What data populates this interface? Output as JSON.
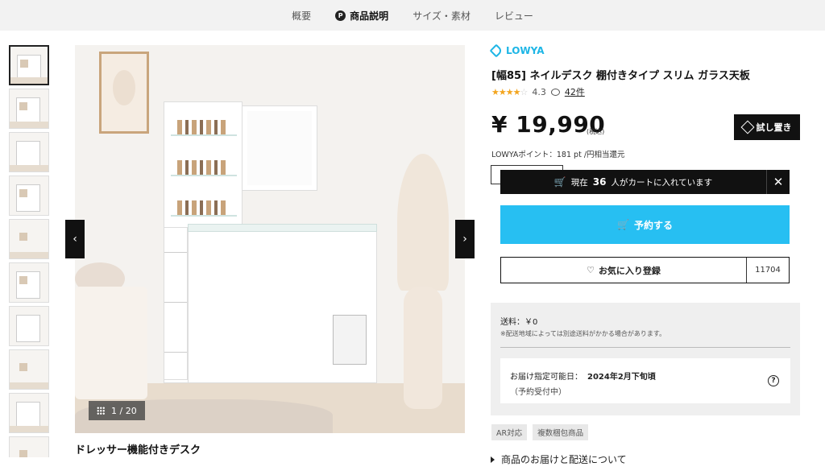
{
  "topnav": {
    "tabs": [
      {
        "label": "概要"
      },
      {
        "label": "商品説明"
      },
      {
        "label": "サイズ・素材"
      },
      {
        "label": "レビュー"
      }
    ],
    "active_tab": "商品説明"
  },
  "gallery": {
    "counter": "1 / 20",
    "caption": "ドレッサー機能付きデスク",
    "thumbnail_count": 10
  },
  "product": {
    "brand": "LOWYA",
    "title": "[幅85] ネイルデスク 棚付きタイプ スリム ガラス天板",
    "rating_value": "4.3",
    "stars_filled": 4,
    "reviews": "42件",
    "price": "¥ 19,990",
    "tax": "(税込)",
    "try_button": "試し置き",
    "points": "LOWYAポイント：181 pt /円相当還元"
  },
  "cart_banner": {
    "prefix": "現在",
    "count": "36",
    "suffix": "人がカートに入れています"
  },
  "actions": {
    "reserve": "予約する",
    "favorite": "お気に入り登録",
    "favorite_count": "11704"
  },
  "shipping": {
    "fee": "送料：￥0",
    "note": "※配送地域によっては別途送料がかかる場合があります。",
    "date_label": "お届け指定可能日：",
    "date_value": "2024年2月下旬頃",
    "status": "（予約受付中）"
  },
  "badges": [
    "AR対応",
    "複数梱包商品"
  ],
  "delivery_link": "商品のお届けと配送について",
  "colors": {
    "accent": "#27bff2",
    "brand": "#1eb6e6",
    "star": "#f3a51f",
    "dark": "#111111"
  }
}
